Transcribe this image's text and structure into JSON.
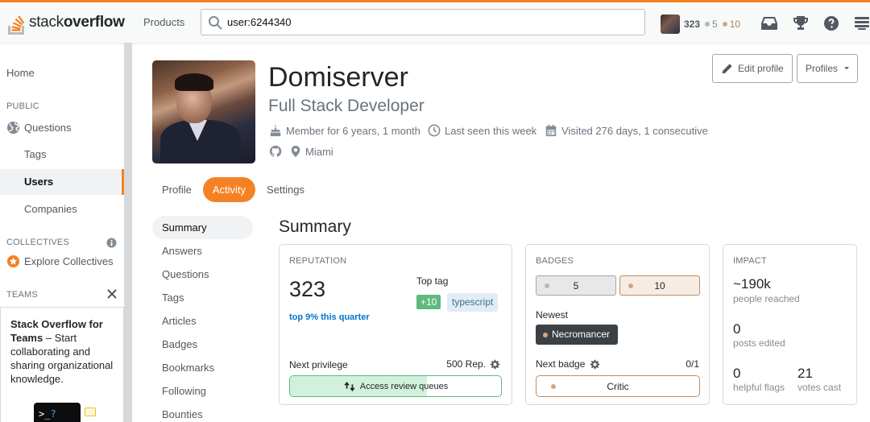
{
  "topbar": {
    "logo_light": "stack",
    "logo_bold": "overflow",
    "products_label": "Products",
    "search_value": "user:6244340",
    "user_rep": "323",
    "silver_count": "5",
    "bronze_count": "10",
    "icons": [
      "inbox-icon",
      "trophy-icon",
      "help-icon",
      "site-switcher-icon"
    ]
  },
  "leftnav": {
    "home": "Home",
    "public_head": "PUBLIC",
    "questions": "Questions",
    "tags": "Tags",
    "users": "Users",
    "companies": "Companies",
    "collectives_head": "COLLECTIVES",
    "explore_collectives": "Explore Collectives",
    "teams_head": "TEAMS",
    "teams_title": "Stack Overflow for Teams",
    "teams_text": " – Start collaborating and sharing organizational knowledge.",
    "teams_prompt": ">_",
    "teams_cursor": "?"
  },
  "profile": {
    "name": "Domiserver",
    "title": "Full Stack Developer",
    "member_for": "Member for 6 years, 1 month",
    "last_seen": "Last seen this week",
    "visited": "Visited 276 days, 1 consecutive",
    "location": "Miami",
    "edit_profile": "Edit profile",
    "profiles": "Profiles"
  },
  "tabs": [
    {
      "label": "Profile",
      "active": false
    },
    {
      "label": "Activity",
      "active": true
    },
    {
      "label": "Settings",
      "active": false
    }
  ],
  "subnav": [
    "Summary",
    "Answers",
    "Questions",
    "Tags",
    "Articles",
    "Badges",
    "Bookmarks",
    "Following",
    "Bounties"
  ],
  "summary": {
    "title": "Summary",
    "reputation": {
      "head": "REPUTATION",
      "value": "323",
      "sub": "top 9% this quarter",
      "top_tag_label": "Top tag",
      "top_tag_score": "+10",
      "top_tag": "typescript",
      "next_privilege_label": "Next privilege",
      "next_privilege_rep": "500 Rep.",
      "privilege_name": "Access review queues",
      "privilege_progress": 0.65
    },
    "badges": {
      "head": "BADGES",
      "silver": "5",
      "bronze": "10",
      "newest_label": "Newest",
      "newest_badge": "Necromancer",
      "next_badge_label": "Next badge",
      "next_badge_progress": "0/1",
      "next_badge_name": "Critic"
    },
    "impact": {
      "head": "IMPACT",
      "reached_value": "~190k",
      "reached_label": "people reached",
      "edited_value": "0",
      "edited_label": "posts edited",
      "flags_value": "0",
      "flags_label": "helpful flags",
      "votes_value": "21",
      "votes_label": "votes cast"
    }
  },
  "colors": {
    "accent": "#f48225",
    "link": "#0074cc",
    "success": "#5eba7d",
    "silver": "#b4b8bc",
    "bronze": "#d1a684"
  }
}
